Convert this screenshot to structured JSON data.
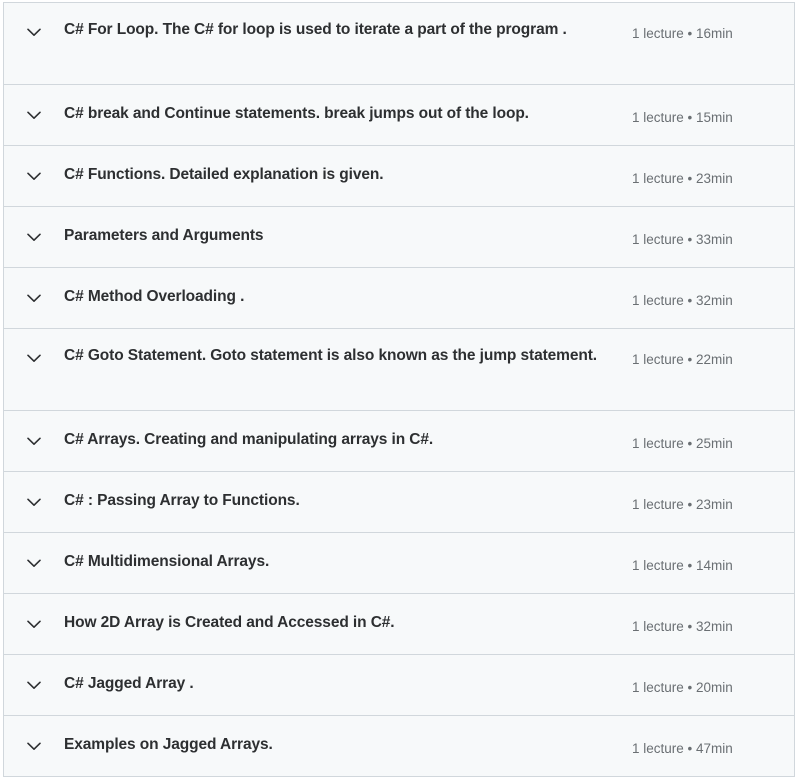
{
  "curriculum": {
    "icons": {
      "toggle": "chevron-down-icon"
    },
    "sections": [
      {
        "title": "C# For Loop. The C# for loop is used to iterate a part of the program .",
        "meta": "1 lecture • 16min",
        "lectures": 1,
        "duration": "16min",
        "lines": 2
      },
      {
        "title": "C# break and Continue statements. break jumps out of the loop.",
        "meta": "1 lecture • 15min",
        "lectures": 1,
        "duration": "15min",
        "lines": 1
      },
      {
        "title": "C# Functions. Detailed explanation is given.",
        "meta": "1 lecture • 23min",
        "lectures": 1,
        "duration": "23min",
        "lines": 1
      },
      {
        "title": "Parameters and Arguments",
        "meta": "1 lecture • 33min",
        "lectures": 1,
        "duration": "33min",
        "lines": 1
      },
      {
        "title": "C# Method Overloading .",
        "meta": "1 lecture • 32min",
        "lectures": 1,
        "duration": "32min",
        "lines": 1
      },
      {
        "title": "C# Goto Statement. Goto statement is also known as the jump statement.",
        "meta": "1 lecture • 22min",
        "lectures": 1,
        "duration": "22min",
        "lines": 2
      },
      {
        "title": "C# Arrays. Creating and manipulating arrays in C#.",
        "meta": "1 lecture • 25min",
        "lectures": 1,
        "duration": "25min",
        "lines": 1
      },
      {
        "title": "C# : Passing Array to Functions.",
        "meta": "1 lecture • 23min",
        "lectures": 1,
        "duration": "23min",
        "lines": 1
      },
      {
        "title": "C# Multidimensional Arrays.",
        "meta": "1 lecture • 14min",
        "lectures": 1,
        "duration": "14min",
        "lines": 1
      },
      {
        "title": "How 2D Array is Created and Accessed in C#.",
        "meta": "1 lecture • 32min",
        "lectures": 1,
        "duration": "32min",
        "lines": 1
      },
      {
        "title": "C# Jagged Array .",
        "meta": "1 lecture • 20min",
        "lectures": 1,
        "duration": "20min",
        "lines": 1
      },
      {
        "title": "Examples on Jagged Arrays.",
        "meta": "1 lecture • 47min",
        "lectures": 1,
        "duration": "47min",
        "lines": 1
      }
    ],
    "colors": {
      "row_background": "#f7f9fa",
      "border": "#d1d7dc",
      "title_text": "#2d2f31",
      "meta_text": "#6a6f73"
    }
  }
}
